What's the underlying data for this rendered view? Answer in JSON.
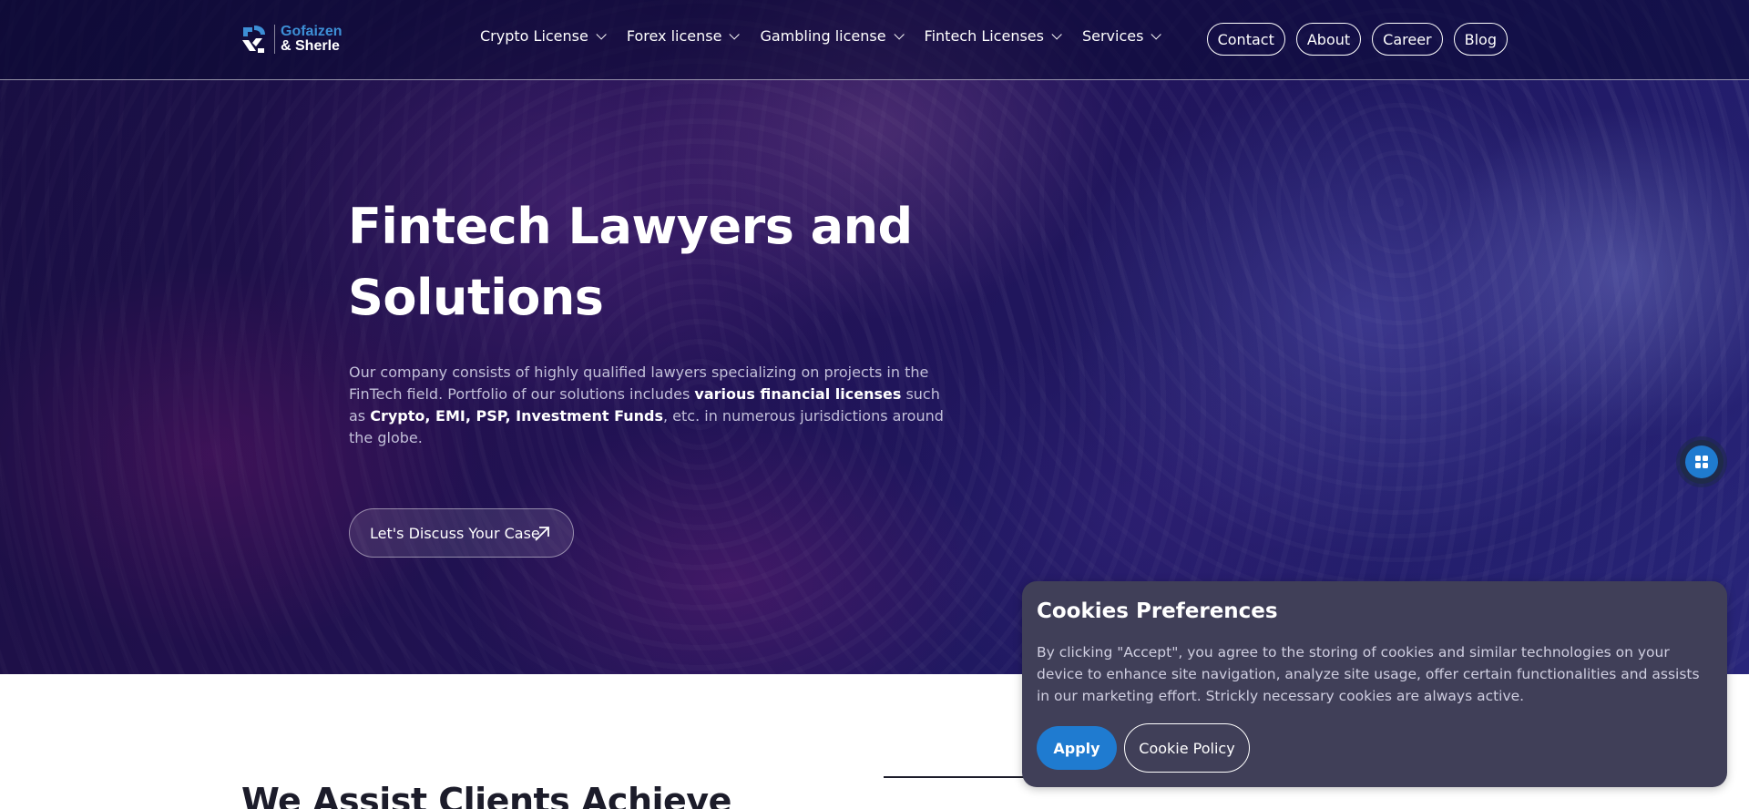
{
  "brand": {
    "line1": "Gofaizen",
    "line2": "& Sherle"
  },
  "nav": {
    "menu": [
      {
        "label": "Crypto License"
      },
      {
        "label": "Forex license"
      },
      {
        "label": "Gambling license"
      },
      {
        "label": "Fintech Licenses"
      },
      {
        "label": "Services"
      }
    ],
    "pills": [
      {
        "label": "Contact"
      },
      {
        "label": "About"
      },
      {
        "label": "Career"
      },
      {
        "label": "Blog"
      }
    ]
  },
  "hero": {
    "title_line1": "Fintech Lawyers and",
    "title_line2": "Solutions",
    "desc_part1": "Our company consists of highly qualified lawyers specializing on projects in the FinTech field. Portfolio of our solutions includes ",
    "desc_bold1": "various financial licenses",
    "desc_part2": " such as ",
    "desc_bold2": "Crypto, EMI, PSP, Investment Funds",
    "desc_part3": ", etc. in numerous jurisdictions around the globe.",
    "cta_label": "Let's Discuss Your Case"
  },
  "section": {
    "title": "We Assist Clients Achieve"
  },
  "cookies": {
    "title": "Cookies Preferences",
    "text": "By clicking \"Accept\", you agree to the storing of cookies and similar technologies on your device to enhance site navigation, analyze site usage, offer certain functionalities and assists in our marketing effort. Strickly necessary cookies are always active.",
    "apply_label": "Apply",
    "policy_label": "Cookie Policy"
  },
  "colors": {
    "accent_blue": "#1f7bd0",
    "cookie_bg": "#403f58",
    "hero_dark": "#1d1250"
  },
  "icons": [
    "logo-mark-icon",
    "chevron-down-icon",
    "arrow-up-right-icon",
    "grid-icon"
  ]
}
